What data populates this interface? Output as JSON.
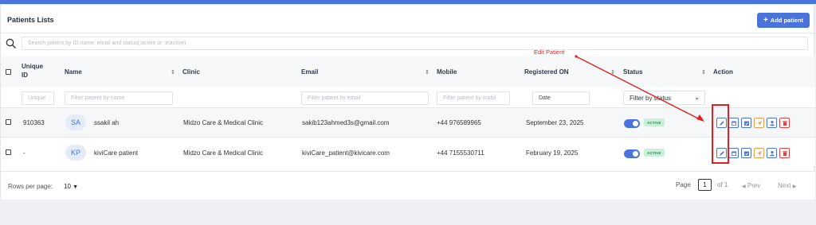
{
  "header": {
    "title": "Patients Lists",
    "add_label": "Add patient"
  },
  "search": {
    "placeholder": "Search patient by ID,name, email and status(:active or :inactive)"
  },
  "columns": {
    "unique_id": "Unique ID",
    "name": "Name",
    "clinic": "Clinic",
    "email": "Email",
    "mobile": "Mobile",
    "registered": "Registered ON",
    "status": "Status",
    "action": "Action"
  },
  "filters": {
    "unique": "Unique",
    "name": "Filter patient by name",
    "email": "Filter patient by email",
    "mobile": "Filter patient by mobil",
    "date": "Date",
    "status": "Filter by status"
  },
  "rows": [
    {
      "id": "910363",
      "initials": "SA",
      "name": "ssakil ah",
      "clinic": "Midzo Care & Medical Clinic",
      "email": "sakib123ahmed3s@gmail.com",
      "mobile": "+44 976589965",
      "registered": "September 23, 2025",
      "status": "ACTIVE"
    },
    {
      "id": "-",
      "initials": "KP",
      "name": "kiviCare patient",
      "clinic": "Midzo Care & Medical Clinic",
      "email": "kiviCare_patient@kivicare.com",
      "mobile": "+44 7155530711",
      "registered": "February 19, 2025",
      "status": "ACTIVE"
    }
  ],
  "footer": {
    "rows_label": "Rows per page:",
    "rows_value": "10",
    "page_label": "Page",
    "page_value": "1",
    "of_label": "of 1",
    "prev": "Prev",
    "next": "Next"
  },
  "annotation": {
    "text": "Edit Patient"
  },
  "colors": {
    "primary": "#4874dc",
    "danger": "#e04141",
    "warning": "#f29b4e",
    "success": "#1e8f4e",
    "annotation": "#e02020"
  }
}
